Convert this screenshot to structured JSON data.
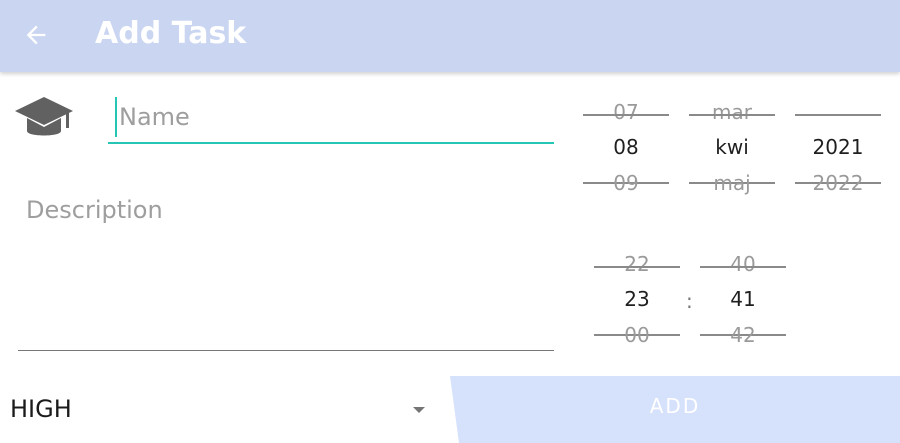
{
  "app_bar": {
    "title": "Add Task",
    "back_icon": "arrow-left-icon",
    "background": "#cad6f1"
  },
  "form": {
    "name_placeholder": "Name",
    "name_value": "",
    "description_placeholder": "Description",
    "description_value": "",
    "accent_color": "#26c6b4",
    "category_icon": "graduation-cap-icon"
  },
  "date_picker": {
    "day": {
      "prev": "07",
      "current": "08",
      "next": "09"
    },
    "month": {
      "prev": "mar",
      "current": "kwi",
      "next": "maj"
    },
    "year": {
      "prev": "",
      "current": "2021",
      "next": "2022"
    }
  },
  "time_picker": {
    "hour": {
      "prev": "22",
      "current": "23",
      "next": "00"
    },
    "minute": {
      "prev": "40",
      "current": "41",
      "next": "42"
    },
    "separator": ":"
  },
  "priority": {
    "value": "HIGH",
    "dropdown_icon": "dropdown-arrow-icon"
  },
  "add_button": {
    "label": "ADD",
    "color": "#d6e1fb"
  }
}
